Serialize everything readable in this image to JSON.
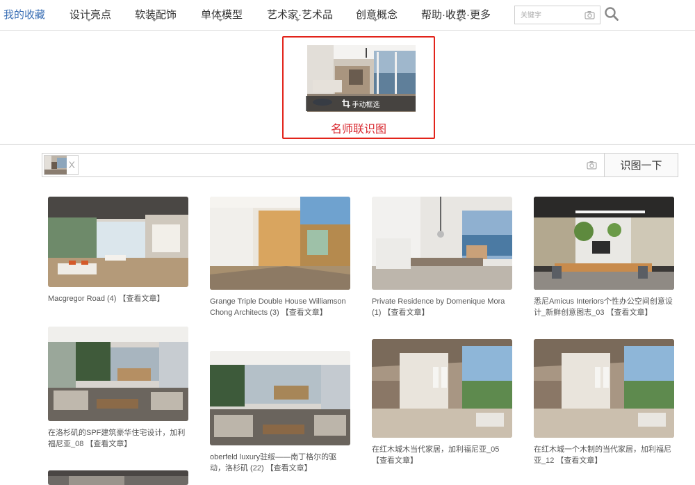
{
  "nav": {
    "items": [
      {
        "label": "我的收藏",
        "caret": false
      },
      {
        "label": "设计亮点",
        "caret": true
      },
      {
        "label": "软装配饰",
        "caret": true
      },
      {
        "label": "单体模型",
        "caret": true
      },
      {
        "label": "艺术家·艺术品",
        "caret": true
      },
      {
        "label": "创意概念",
        "caret": true
      },
      {
        "label": "帮助·收费·更多",
        "caret": true
      }
    ],
    "search_placeholder": "关键字"
  },
  "preview": {
    "crop_label": "手动框选",
    "title": "名师联识图"
  },
  "image_search": {
    "remove_label": "X",
    "button_label": "识图一下"
  },
  "results": [
    {
      "title": "Macgregor Road (4)",
      "more": "【查看文章】"
    },
    {
      "title": "Grange Triple Double House Williamson Chong Architects (3)",
      "more": "【查看文章】"
    },
    {
      "title": "Private Residence by Domenique Mora (1)",
      "more": "【查看文章】"
    },
    {
      "title": "悉尼Amicus Interiors个性办公空间创意设计_新鲜创意图志_03",
      "more": "【查看文章】"
    },
    {
      "title": "在洛杉矶的SPF建筑豪华住宅设计，加利福尼亚_08",
      "more": "【查看文章】"
    },
    {
      "title": "oberfeld luxury驻绥——南丁格尔的驱动，洛杉矶 (22)",
      "more": "【查看文章】"
    },
    {
      "title": "在红木城木当代家居，加利福尼亚_05",
      "more": "【查看文章】"
    },
    {
      "title": "在红木城一个木制的当代家居，加利福尼亚_12",
      "more": "【查看文章】"
    },
    {
      "title": "",
      "more": ""
    }
  ]
}
